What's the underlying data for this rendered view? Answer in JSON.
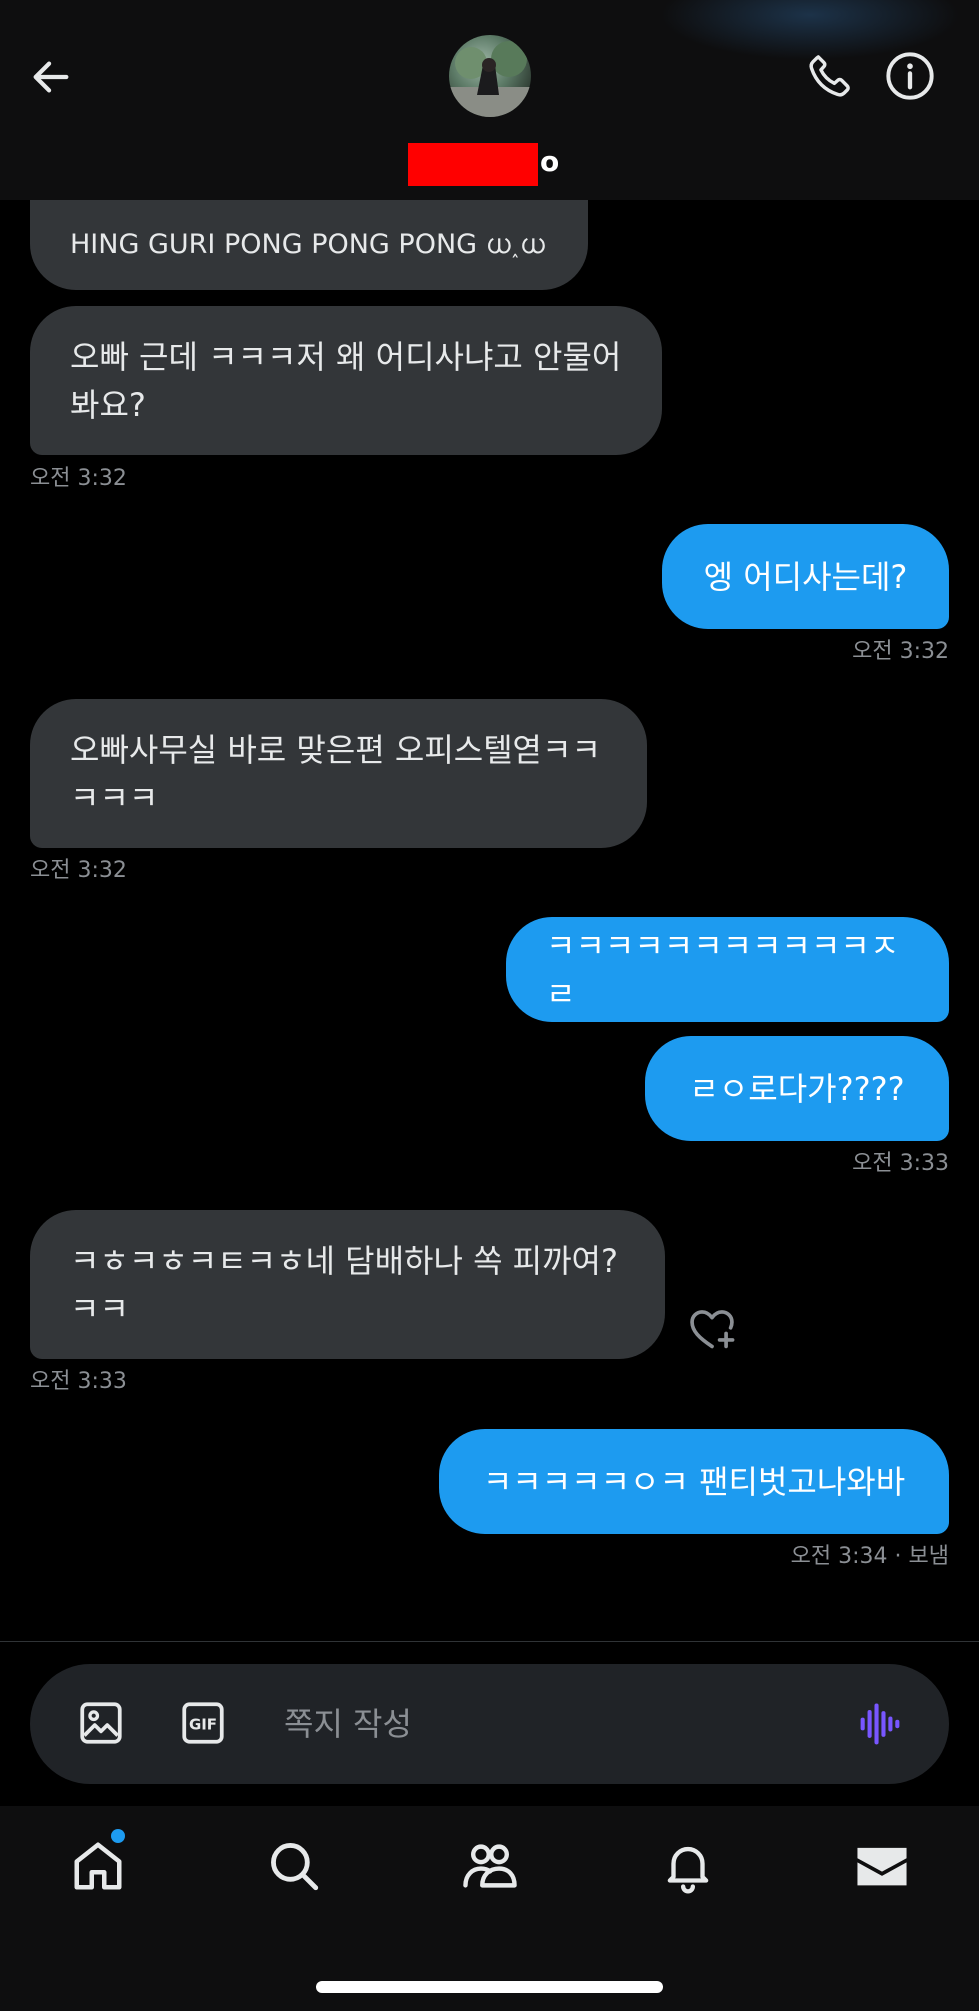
{
  "header": {
    "name_suffix": "o",
    "back_label": "Back",
    "call_label": "Call",
    "info_label": "Info"
  },
  "messages": [
    {
      "dir": "in",
      "text": "HING GURI PONG PONG PONG ധ˰ധ"
    },
    {
      "dir": "in",
      "text": "오빠 근데 ㅋㅋㅋ저 왜 어디사냐고 안물어\n봐요?"
    },
    {
      "timestamp": "오전 3:32"
    },
    {
      "dir": "out",
      "text": "엥 어디사는데?"
    },
    {
      "timestamp": "오전 3:32"
    },
    {
      "dir": "in",
      "text": "오빠사무실 바로 맞은편 오피스텔엳ㅋㅋ\nㅋㅋㅋ"
    },
    {
      "timestamp": "오전 3:32"
    },
    {
      "dir": "out",
      "text": "ㅋㅋㅋㅋㅋㅋㅋㅋㅋㅋㅋㅈㄹ"
    },
    {
      "dir": "out",
      "text": "ㄹㅇ로다가????"
    },
    {
      "timestamp": "오전 3:33"
    },
    {
      "dir": "in",
      "text": "ㅋㅎㅋㅎㅋㅌㅋㅎ네 담배하나 쏙 피까여?\nㅋㅋ"
    },
    {
      "timestamp": "오전 3:33"
    },
    {
      "dir": "out",
      "text": "ㅋㅋㅋㅋㅋㅇㅋ 팬티벗고나와바"
    },
    {
      "timestamp": "오전 3:34 · 보냄"
    }
  ],
  "composer": {
    "placeholder": "쪽지 작성"
  },
  "colors": {
    "background": "#000000",
    "incoming_bubble": "#333639",
    "outgoing_bubble": "#1d9bf0",
    "timestamp": "#8b8f94",
    "voice_accent": "#7856ff",
    "notification_dot": "#1d9bf0"
  },
  "icons": {
    "back": "arrow-left-icon",
    "call": "phone-icon",
    "info": "info-icon",
    "media": "image-icon",
    "gif": "gif-icon",
    "voice": "voice-wave-icon",
    "react": "heart-plus-icon",
    "nav": [
      "home-icon",
      "search-icon",
      "people-icon",
      "bell-icon",
      "mail-icon"
    ]
  }
}
